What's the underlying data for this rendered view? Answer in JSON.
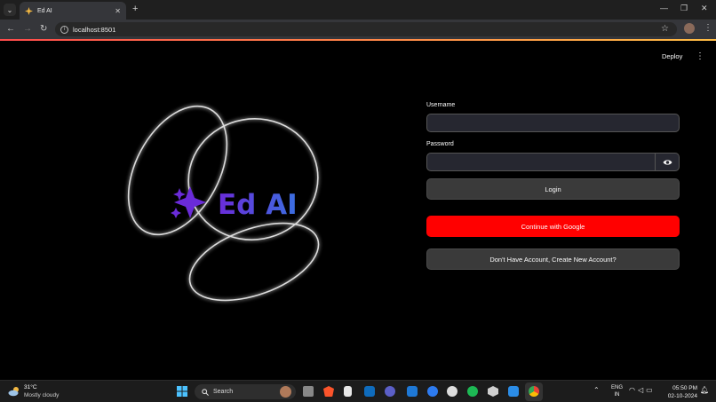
{
  "browser": {
    "tab_title": "Ed AI",
    "new_tab": "+",
    "url": "localhost:8501",
    "minimize": "—",
    "restore": "❐",
    "close": "✕"
  },
  "app": {
    "deploy_label": "Deploy",
    "logo_text": "Ed AI",
    "username_label": "Username",
    "username_value": "",
    "password_label": "Password",
    "password_value": "",
    "login_label": "Login",
    "google_label": "Continue with Google",
    "signup_label": "Don't Have Account, Create New Account?",
    "colors": {
      "google_button": "#ff0000",
      "logo_purple": "#6a2bd9",
      "logo_blue": "#3b5bdb"
    }
  },
  "taskbar": {
    "temperature": "31°C",
    "weather": "Mostly cloudy",
    "search_label": "Search",
    "lang_line1": "ENG",
    "lang_line2": "IN",
    "time": "05:50 PM",
    "date": "02-10-2024",
    "apps": [
      "task-view-icon",
      "brave-icon",
      "files-icon",
      "outlook-icon",
      "teams-icon",
      "mail-icon",
      "messenger-icon",
      "app-icon",
      "spotify-icon",
      "package-icon",
      "vscode-icon",
      "chrome-icon"
    ]
  }
}
